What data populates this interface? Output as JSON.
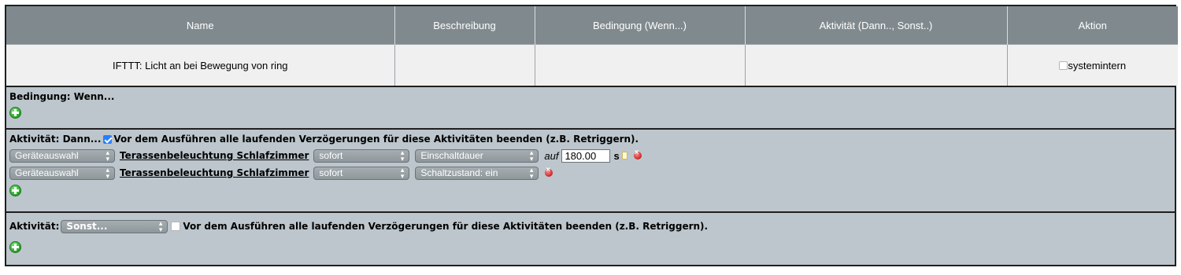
{
  "table": {
    "headers": [
      "Name",
      "Beschreibung",
      "Bedingung (Wenn...)",
      "Aktivität (Dann.., Sonst..)",
      "Aktion"
    ],
    "row": {
      "name": "IFTTT: Licht an bei Bewegung von ring",
      "beschreibung": "",
      "bedingung": "",
      "aktivitaet": "",
      "aktion_label": "systemintern",
      "aktion_checked": false
    }
  },
  "condition": {
    "label": "Bedingung: Wenn..."
  },
  "activity_then": {
    "label": "Aktivität: Dann...",
    "stop_delays_checked": true,
    "stop_delays_text": "Vor dem Ausführen alle laufenden Verzögerungen für diese Aktivitäten beenden (z.B. Retriggern).",
    "rows": [
      {
        "source": "Geräteauswahl",
        "device": "Terassenbeleuchtung Schlafzimmer",
        "timing": "sofort",
        "param": "Einschaltdauer",
        "auf": "auf",
        "value": "180.00",
        "unit": "s"
      },
      {
        "source": "Geräteauswahl",
        "device": "Terassenbeleuchtung Schlafzimmer",
        "timing": "sofort",
        "param": "Schaltzustand: ein"
      }
    ]
  },
  "activity_else": {
    "label": "Aktivität:",
    "select": "Sonst...",
    "stop_delays_checked": false,
    "stop_delays_text": "Vor dem Ausführen alle laufenden Verzögerungen für diese Aktivitäten beenden (z.B. Retriggern)."
  },
  "colors": {
    "header_bg": "#808a8e",
    "panel_bg": "#bcc6cc",
    "checkbox_on": "#2a7fff"
  },
  "icons": [
    "add-icon",
    "delete-icon",
    "document-icon",
    "select-arrows-icon"
  ]
}
